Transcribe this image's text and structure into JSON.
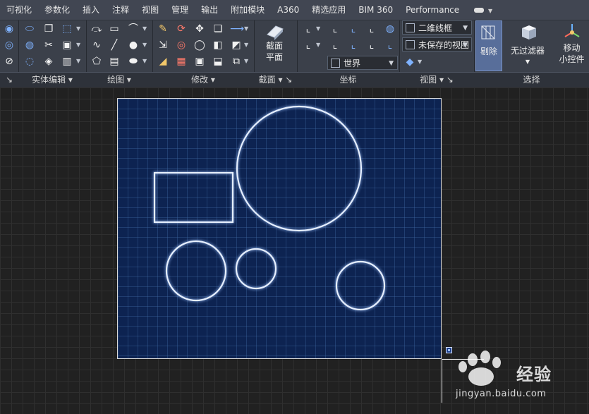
{
  "menubar": {
    "items": [
      "可视化",
      "参数化",
      "插入",
      "注释",
      "视图",
      "管理",
      "输出",
      "附加模块",
      "A360",
      "精选应用",
      "BIM 360",
      "Performance"
    ]
  },
  "ribbon": {
    "panels": [
      "实体编辑",
      "绘图",
      "修改",
      "截面",
      "坐标",
      "视图",
      "选择"
    ],
    "section_plane": {
      "line1": "截面",
      "line2": "平面"
    },
    "visual_style": "二维线框",
    "saved_view": "未保存的视图",
    "ucs": "世界",
    "cull_button": "剔除",
    "filter_button": "无过滤器",
    "gizmo_button": {
      "line1": "移动",
      "line2": "小控件"
    }
  },
  "watermark": {
    "brand": "经验",
    "url": "jingyan.baidu.com"
  },
  "colors": {
    "menubar_bg": "#414652",
    "ribbon_bg": "#3b404a",
    "canvas_bg": "#212121",
    "sheet_bg": "#0d2351",
    "shape_stroke": "#e6efff",
    "active_button": "#586e9a"
  }
}
